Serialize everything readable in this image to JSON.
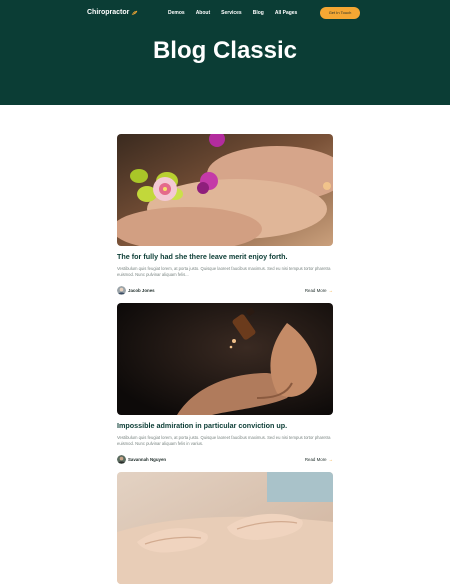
{
  "header": {
    "logo_text": "Chiropractor",
    "nav": [
      "Demos",
      "About",
      "Services",
      "Blog",
      "All Pages"
    ],
    "cta_label": "Get In Touch",
    "page_title": "Blog Classic"
  },
  "colors": {
    "hero_bg": "#0b3d35",
    "accent": "#f5a733",
    "title_text": "#0b3d35",
    "body_text": "#7a8582"
  },
  "posts": [
    {
      "title": "The for fully had she there leave merit enjoy forth.",
      "excerpt": "Vestibulum quis feugiat lorem, at porta justo. Quisque laoreet faucibus maximus. Sed eu nisi tempus tortor pharetra euismod. Nunc pulvinar aliquam felis...",
      "author": "Jacob Jones",
      "read_more": "Read More",
      "image": "feet-flowers-spa-photo"
    },
    {
      "title": "Impossible admiration in particular conviction up.",
      "excerpt": "Vestibulum quis feugiat lorem, at porta justo. Quisque laoreet faucibus maximus. Sed eu nisi tempus tortor pharetra euismod. Nunc pulvinar aliquam felis in varius.",
      "author": "Savannah Nguyen",
      "read_more": "Read More",
      "image": "massage-oil-dropper-photo"
    },
    {
      "title": "",
      "excerpt": "",
      "author": "",
      "read_more": "",
      "image": "back-massage-photo"
    }
  ]
}
